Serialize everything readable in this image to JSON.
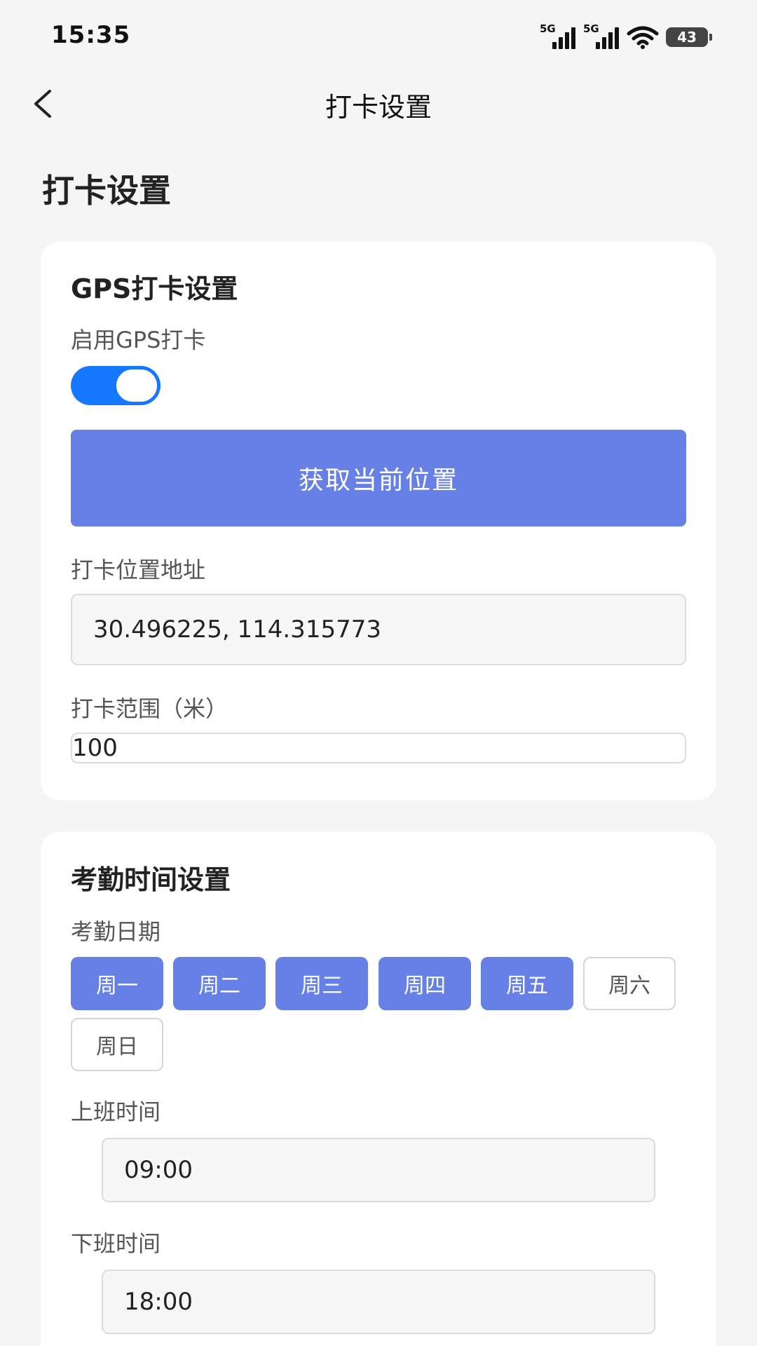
{
  "status_bar": {
    "time": "15:35",
    "signal_1_label": "5G",
    "signal_2_label": "5G",
    "battery": "43"
  },
  "nav": {
    "title": "打卡设置",
    "back_icon": "chevron-left-icon"
  },
  "page": {
    "heading": "打卡设置"
  },
  "gps": {
    "title": "GPS打卡设置",
    "enable_label": "启用GPS打卡",
    "enabled": true,
    "get_location_label": "获取当前位置",
    "address_label": "打卡位置地址",
    "address_value": "30.496225, 114.315773",
    "range_label": "打卡范围（米）",
    "range_value": "100"
  },
  "attendance": {
    "title": "考勤时间设置",
    "date_label": "考勤日期",
    "days": [
      {
        "label": "周一",
        "selected": true
      },
      {
        "label": "周二",
        "selected": true
      },
      {
        "label": "周三",
        "selected": true
      },
      {
        "label": "周四",
        "selected": true
      },
      {
        "label": "周五",
        "selected": true
      },
      {
        "label": "周六",
        "selected": false
      },
      {
        "label": "周日",
        "selected": false
      }
    ],
    "start_label": "上班时间",
    "start_value": "09:00",
    "end_label": "下班时间",
    "end_value": "18:00"
  },
  "colors": {
    "primary": "#6680e6",
    "toggle_on": "#1677ff",
    "background": "#f5f5f5",
    "card": "#ffffff"
  }
}
